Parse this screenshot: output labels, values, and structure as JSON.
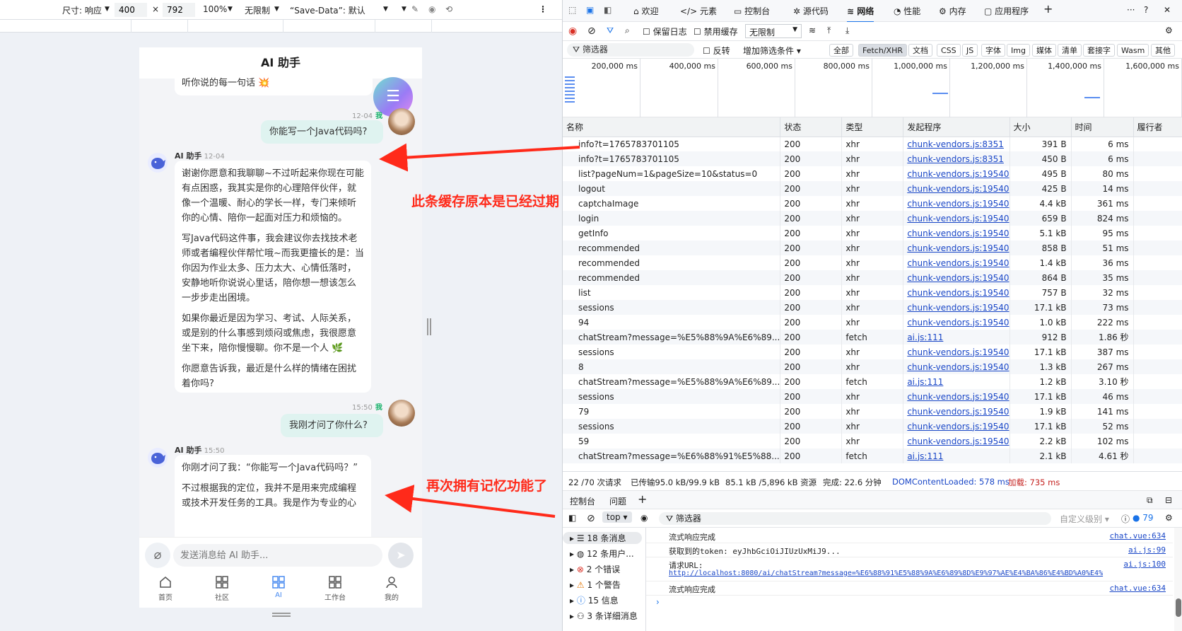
{
  "device_toolbar": {
    "size_label": "尺寸: 响应",
    "width": "400",
    "times": "×",
    "height": "792",
    "zoom": "100%",
    "throttle": "无限制",
    "save_data": "“Save-Data”: 默认"
  },
  "app": {
    "title": "AI 助手",
    "first_ai_tail": "听你说的每一句话 💥",
    "msg1_time": "12-04",
    "me_label": "我",
    "msg1_text": "你能写一个Java代码吗?",
    "ai_name": "AI 助手",
    "ai1_time": "12-04",
    "ai1_paragraphs": [
      "谢谢你愿意和我聊聊~不过听起来你现在可能有点困惑，我其实是你的心理陪伴伙伴，就像一个温暖、耐心的学长一样，专门来倾听你的心情、陪你一起面对压力和烦恼的。",
      "写Java代码这件事，我会建议你去找技术老师或者编程伙伴帮忙哦~而我更擅长的是：当你因为作业太多、压力太大、心情低落时，安静地听你说说心里话，陪你想一想该怎么一步步走出困境。",
      "如果你最近是因为学习、考试、人际关系，或是别的什么事感到烦闷或焦虑，我很愿意坐下来，陪你慢慢聊。你不是一个人 🌿",
      "你愿意告诉我，最近是什么样的情绪在困扰着你吗?"
    ],
    "msg2_time": "15:50",
    "msg2_text": "我刚才问了你什么?",
    "ai2_time": "15:50",
    "ai2_paragraphs": [
      "你刚才问了我：“你能写一个Java代码吗？”",
      "不过根据我的定位，我并不是用来完成编程或技术开发任务的工具。我是作为专业的心"
    ],
    "input_placeholder": "发送消息给 AI 助手...",
    "tabs": [
      "首页",
      "社区",
      "AI",
      "工作台",
      "我的"
    ]
  },
  "annotations": {
    "expired": "此条缓存原本是已经过期",
    "memory": "再次拥有记忆功能了",
    "color": "#ff2a1a"
  },
  "devtools": {
    "panels": [
      "欢迎",
      "元素",
      "控制台",
      "源代码",
      "网络",
      "性能",
      "内存",
      "应用程序"
    ],
    "toolbar": {
      "preserve_log": "保留日志",
      "disable_cache": "禁用缓存",
      "throttle": "无限制"
    },
    "filter_placeholder": "筛选器",
    "invert": "反转",
    "more_filters": "增加筛选条件",
    "type_filters": [
      "全部",
      "Fetch/XHR",
      "文档",
      "CSS",
      "JS",
      "字体",
      "Img",
      "媒体",
      "清单",
      "套接字",
      "Wasm",
      "其他"
    ],
    "timeline_ticks": [
      "200,000 ms",
      "400,000 ms",
      "600,000 ms",
      "800,000 ms",
      "1,000,000 ms",
      "1,200,000 ms",
      "1,400,000 ms",
      "1,600,000 ms"
    ],
    "columns": [
      "名称",
      "状态",
      "类型",
      "发起程序",
      "大小",
      "时间",
      "履行者"
    ],
    "rows": [
      [
        "info?t=1765783701105",
        "200",
        "xhr",
        "chunk-vendors.js:8351",
        "391 B",
        "6 ms"
      ],
      [
        "info?t=1765783701105",
        "200",
        "xhr",
        "chunk-vendors.js:8351",
        "450 B",
        "6 ms"
      ],
      [
        "list?pageNum=1&pageSize=10&status=0",
        "200",
        "xhr",
        "chunk-vendors.js:19540",
        "495 B",
        "80 ms"
      ],
      [
        "logout",
        "200",
        "xhr",
        "chunk-vendors.js:19540",
        "425 B",
        "14 ms"
      ],
      [
        "captchaImage",
        "200",
        "xhr",
        "chunk-vendors.js:19540",
        "4.4 kB",
        "361 ms"
      ],
      [
        "login",
        "200",
        "xhr",
        "chunk-vendors.js:19540",
        "659 B",
        "824 ms"
      ],
      [
        "getInfo",
        "200",
        "xhr",
        "chunk-vendors.js:19540",
        "5.1 kB",
        "95 ms"
      ],
      [
        "recommended",
        "200",
        "xhr",
        "chunk-vendors.js:19540",
        "858 B",
        "51 ms"
      ],
      [
        "recommended",
        "200",
        "xhr",
        "chunk-vendors.js:19540",
        "1.4 kB",
        "36 ms"
      ],
      [
        "recommended",
        "200",
        "xhr",
        "chunk-vendors.js:19540",
        "864 B",
        "35 ms"
      ],
      [
        "list",
        "200",
        "xhr",
        "chunk-vendors.js:19540",
        "757 B",
        "32 ms"
      ],
      [
        "sessions",
        "200",
        "xhr",
        "chunk-vendors.js:19540",
        "17.1 kB",
        "73 ms"
      ],
      [
        "94",
        "200",
        "xhr",
        "chunk-vendors.js:19540",
        "1.0 kB",
        "222 ms"
      ],
      [
        "chatStream?message=%E5%88%9A%E6%89...",
        "200",
        "fetch",
        "ai.js:111",
        "912 B",
        "1.86 秒"
      ],
      [
        "sessions",
        "200",
        "xhr",
        "chunk-vendors.js:19540",
        "17.1 kB",
        "387 ms"
      ],
      [
        "8",
        "200",
        "xhr",
        "chunk-vendors.js:19540",
        "1.3 kB",
        "267 ms"
      ],
      [
        "chatStream?message=%E5%88%9A%E6%89...",
        "200",
        "fetch",
        "ai.js:111",
        "1.2 kB",
        "3.10 秒"
      ],
      [
        "sessions",
        "200",
        "xhr",
        "chunk-vendors.js:19540",
        "17.1 kB",
        "46 ms"
      ],
      [
        "79",
        "200",
        "xhr",
        "chunk-vendors.js:19540",
        "1.9 kB",
        "141 ms"
      ],
      [
        "sessions",
        "200",
        "xhr",
        "chunk-vendors.js:19540",
        "17.1 kB",
        "52 ms"
      ],
      [
        "59",
        "200",
        "xhr",
        "chunk-vendors.js:19540",
        "2.2 kB",
        "102 ms"
      ],
      [
        "chatStream?message=%E6%88%91%E5%88...",
        "200",
        "fetch",
        "ai.js:111",
        "2.1 kB",
        "4.61 秒"
      ]
    ],
    "status_bar": {
      "requests": "22 /70 次请求",
      "transferred": "已传输95.0 kB/99.9 kB",
      "resources": "85.1 kB /5,896 kB 资源",
      "finish": "完成: 22.6 分钟",
      "dcl": "DOMContentLoaded: 578 ms",
      "load": "加载: 735 ms"
    },
    "drawer_tabs": [
      "控制台",
      "问题"
    ],
    "console_context": "top",
    "console_filter": "筛选器",
    "levels": "自定义级别",
    "issues_count": "79",
    "sidebar": [
      "18 条消息",
      "12 条用户...",
      "2 个错误",
      "1 个警告",
      "15 信息",
      "3 条详细消息"
    ],
    "console_lines": [
      {
        "text": "流式响应完成",
        "src": "chat.vue:634"
      },
      {
        "text": "获取到的token: eyJhbGciOiJIUzUxMiJ9...",
        "src": "ai.js:99"
      },
      {
        "text": "请求URL:",
        "src": "ai.js:100"
      },
      {
        "text": "http://localhost:8080/ai/chatStream?message=%E6%88%91%E5%88%9A%E6%89%8D%E9%97%AE%E4%BA%86%E4%BD%A0%E4%",
        "src": ""
      },
      {
        "text": "流式响应完成",
        "src": "chat.vue:634"
      }
    ]
  }
}
